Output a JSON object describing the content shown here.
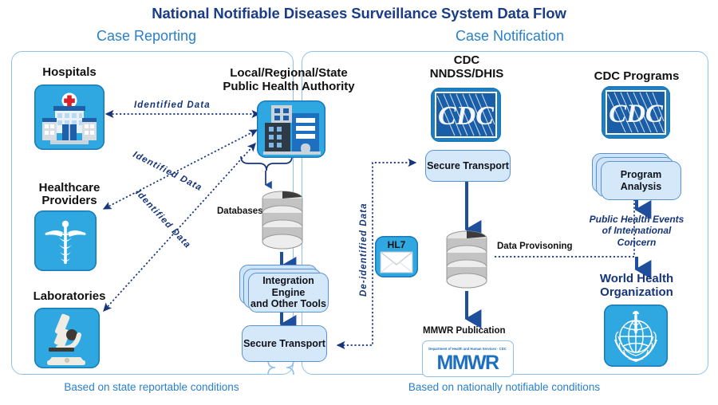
{
  "title": "National Notifiable Diseases Surveillance System Data Flow",
  "sections": {
    "reporting": {
      "heading": "Case Reporting",
      "caption": "Based on state reportable conditions"
    },
    "notification": {
      "heading": "Case Notification",
      "caption": "Based on nationally notifiable conditions"
    }
  },
  "nodes": {
    "hospitals": "Hospitals",
    "healthcare_providers": "Healthcare\nProviders",
    "healthcare_providers_l1": "Healthcare",
    "healthcare_providers_l2": "Providers",
    "laboratories": "Laboratories",
    "authority_l1": "Local/Regional/State",
    "authority_l2": "Public Health Authority",
    "databases": "Databases",
    "integration_engine": "Integration Engine and Other Tools",
    "integration_engine_l1": "Integration Engine",
    "integration_engine_l2": "and Other Tools",
    "secure_transport_left": "Secure Transport",
    "secure_transport_right": "Secure Transport",
    "cdc_nndss_l1": "CDC",
    "cdc_nndss_l2": "NNDSS/DHIS",
    "cdc_programs": "CDC Programs",
    "program_analysis_l1": "Program",
    "program_analysis_l2": "Analysis",
    "mmwr_publication": "MMWR Publication",
    "who_l1": "World Health",
    "who_l2": "Organization",
    "hl7": "HL7"
  },
  "logos": {
    "cdc_text": "CDC",
    "mmwr_text": "MMWR",
    "mmwr_subtext": "Department of Health and Human Services Centers for Disease Control and Prevention"
  },
  "annotations": {
    "identified_data_1": "Identified Data",
    "identified_data_2": "Identified Data",
    "identified_data_3": "Identified Data",
    "deidentified_data": "De-identified Data",
    "data_provisioning": "Data Provisoning",
    "public_health_events": "Public Health Events of International Concern",
    "public_health_events_l1": "Public Health Events",
    "public_health_events_l2": "of International",
    "public_health_events_l3": "Concern"
  },
  "colors": {
    "title_navy": "#1b3c86",
    "heading_blue": "#2a7fc9",
    "panel_border": "#8fc0e8",
    "tile_blue": "#2fa8e2",
    "box_fill": "#d5e8fa",
    "box_border": "#5a93cf",
    "arrow_navy": "#1f4e9c",
    "dotted_navy": "#16357a",
    "red_cross": "#d8232a"
  }
}
